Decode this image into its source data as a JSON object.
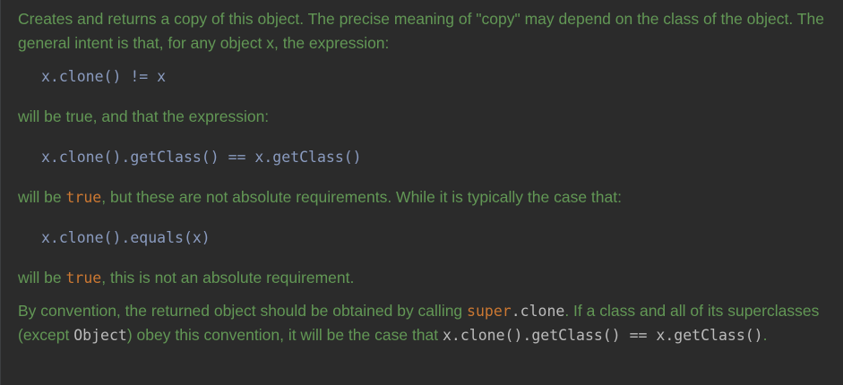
{
  "doc": {
    "p1": "Creates and returns a copy of this object. The precise meaning of \"copy\" may depend on the class of the object. The general intent is that, for any object x, the expression:",
    "code1": "x.clone() != x",
    "p2": "will be true, and that the expression:",
    "code2": "x.clone().getClass() == x.getClass()",
    "p3_pre": "will be ",
    "p3_code": "true",
    "p3_post": ", but these are not absolute requirements. While it is typically the case that:",
    "code3": "x.clone().equals(x)",
    "p4_pre": "will be ",
    "p4_code": "true",
    "p4_post": ", this is not an absolute requirement.",
    "p5_a": "By convention, the returned object should be obtained by calling ",
    "p5_super": "super",
    "p5_clone": ".clone",
    "p5_b": ". If a class and all of its superclasses (except ",
    "p5_object": "Object",
    "p5_c": ") obey this convention, it will be the case that ",
    "p5_expr": "x.clone().getClass() == x.getClass()",
    "p5_d": "."
  },
  "colors": {
    "background": "#2b2b2b",
    "doc_text": "#629755",
    "code_text": "#8a9bbf",
    "keyword": "#cc7832",
    "inline_code": "#bbbbbb"
  }
}
